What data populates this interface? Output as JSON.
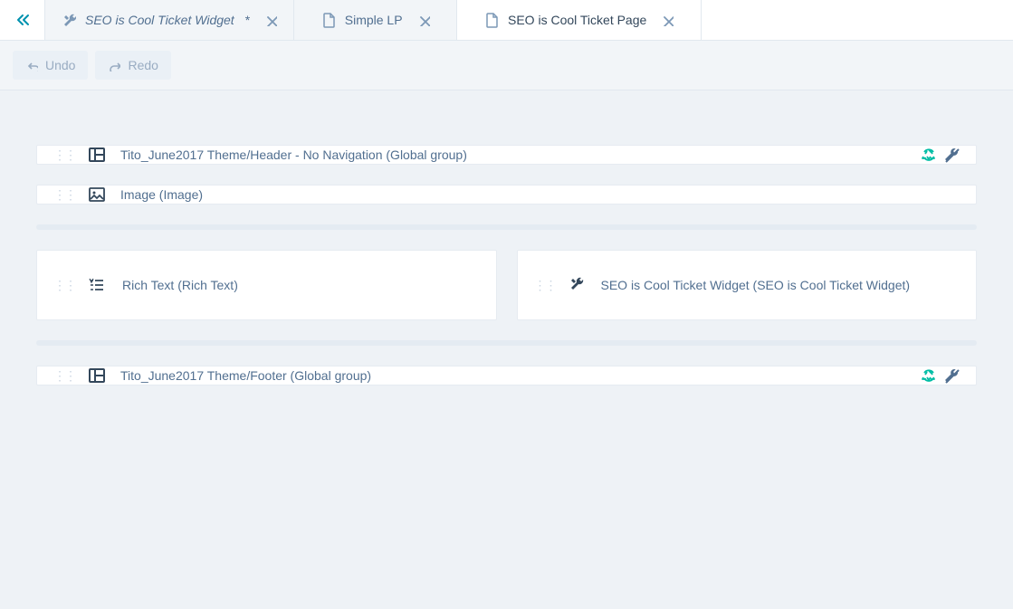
{
  "tabs": [
    {
      "label": "SEO is Cool Ticket Widget",
      "dirty": true,
      "icon": "wrench",
      "active": false,
      "italic": true
    },
    {
      "label": "Simple LP",
      "dirty": false,
      "icon": "page",
      "active": false,
      "italic": false
    },
    {
      "label": "SEO is Cool Ticket Page",
      "dirty": false,
      "icon": "page",
      "active": true,
      "italic": false
    }
  ],
  "toolbar": {
    "undo_label": "Undo",
    "redo_label": "Redo"
  },
  "modules": {
    "header": "Tito_June2017 Theme/Header - No Navigation (Global group)",
    "image": "Image (Image)",
    "richtext": "Rich Text (Rich Text)",
    "widget": "SEO is Cool Ticket Widget (SEO is Cool Ticket Widget)",
    "footer": "Tito_June2017 Theme/Footer (Global group)"
  }
}
